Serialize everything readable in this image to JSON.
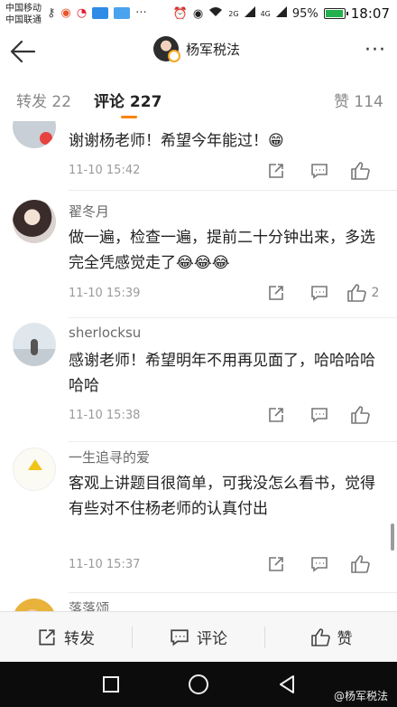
{
  "status_bar": {
    "carrier_1": "中国移动",
    "carrier_2": "中国联通",
    "network_1": "2G",
    "network_2": "4G",
    "battery": "95%",
    "time": "18:07"
  },
  "header": {
    "title": "杨军税法",
    "more": "···"
  },
  "tabs": [
    {
      "label": "转发 22"
    },
    {
      "label": "评论 227"
    },
    {
      "label": "赞 114"
    }
  ],
  "comments": [
    {
      "username": "",
      "text": "谢谢杨老师！希望今年能过！😁",
      "time": "11-10 15:42",
      "likes": ""
    },
    {
      "username": "翟冬月",
      "text": "做一遍，检查一遍，提前二十分钟出来，多选完全凭感觉走了😂😂😂",
      "time": "11-10 15:39",
      "likes": "2"
    },
    {
      "username": "sherlocksu",
      "text": "感谢老师！希望明年不用再见面了，哈哈哈哈哈哈",
      "time": "11-10 15:38",
      "likes": ""
    },
    {
      "username": "一生追寻的爱",
      "text": "客观上讲题目很简单，可我没怎么看书，觉得有些对不住杨老师的认真付出",
      "time": "11-10 15:37",
      "likes": ""
    },
    {
      "username": "落落颂",
      "text": "",
      "time": "",
      "likes": ""
    }
  ],
  "bottom_toolbar": {
    "repost": "转发",
    "comment": "评论",
    "like": "赞"
  },
  "watermark": "@杨军税法",
  "colors": {
    "accent": "#ff8200",
    "nav_bg": "#0c0c0c",
    "battery": "#22b14c"
  }
}
